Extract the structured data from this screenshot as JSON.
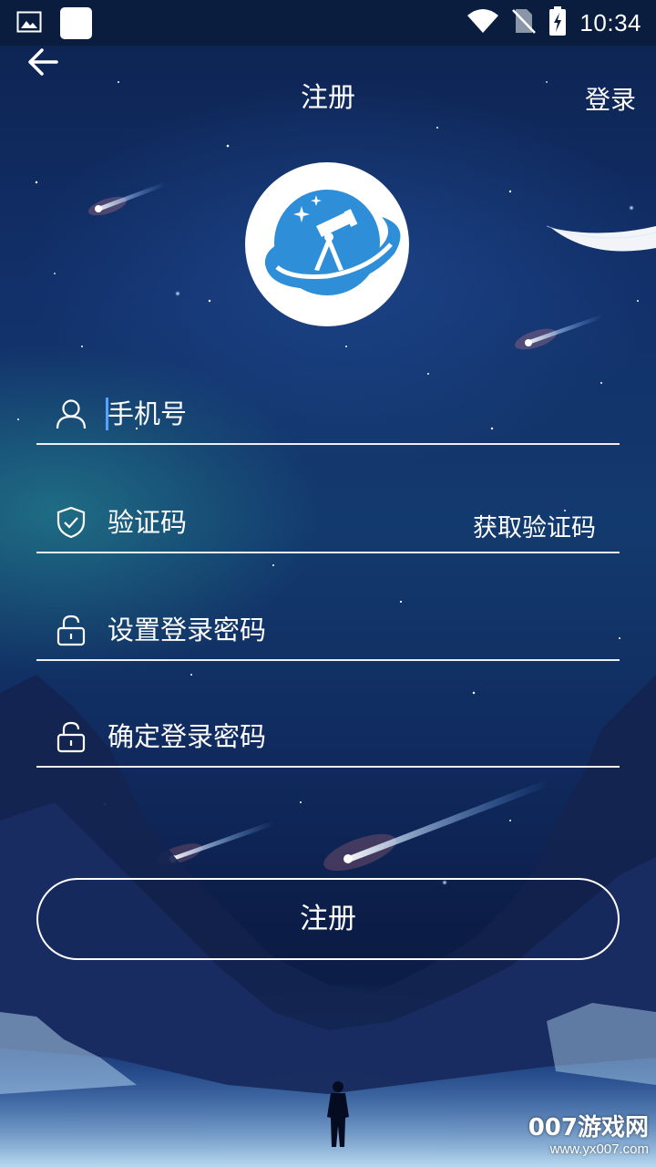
{
  "status_bar": {
    "time": "10:34",
    "icons": [
      "image-icon",
      "app-notification-icon",
      "wifi-icon",
      "no-sim-icon",
      "battery-charging-icon"
    ]
  },
  "header": {
    "title": "注册",
    "login_link": "登录"
  },
  "form": {
    "phone": {
      "placeholder": "手机号",
      "value": "",
      "icon": "user-icon"
    },
    "code": {
      "placeholder": "验证码",
      "value": "",
      "icon": "shield-check-icon",
      "action": "获取验证码"
    },
    "password": {
      "placeholder": "设置登录密码",
      "value": "",
      "icon": "lock-icon"
    },
    "confirm_password": {
      "placeholder": "确定登录密码",
      "value": "",
      "icon": "lock-icon"
    },
    "submit_label": "注册"
  },
  "watermark": {
    "brand": "007游戏网",
    "url": "www.yx007.com"
  },
  "colors": {
    "logo_blue": "#2e8fd8",
    "background_dark": "#0b1a40",
    "status_bar": "#0a1d3f"
  }
}
